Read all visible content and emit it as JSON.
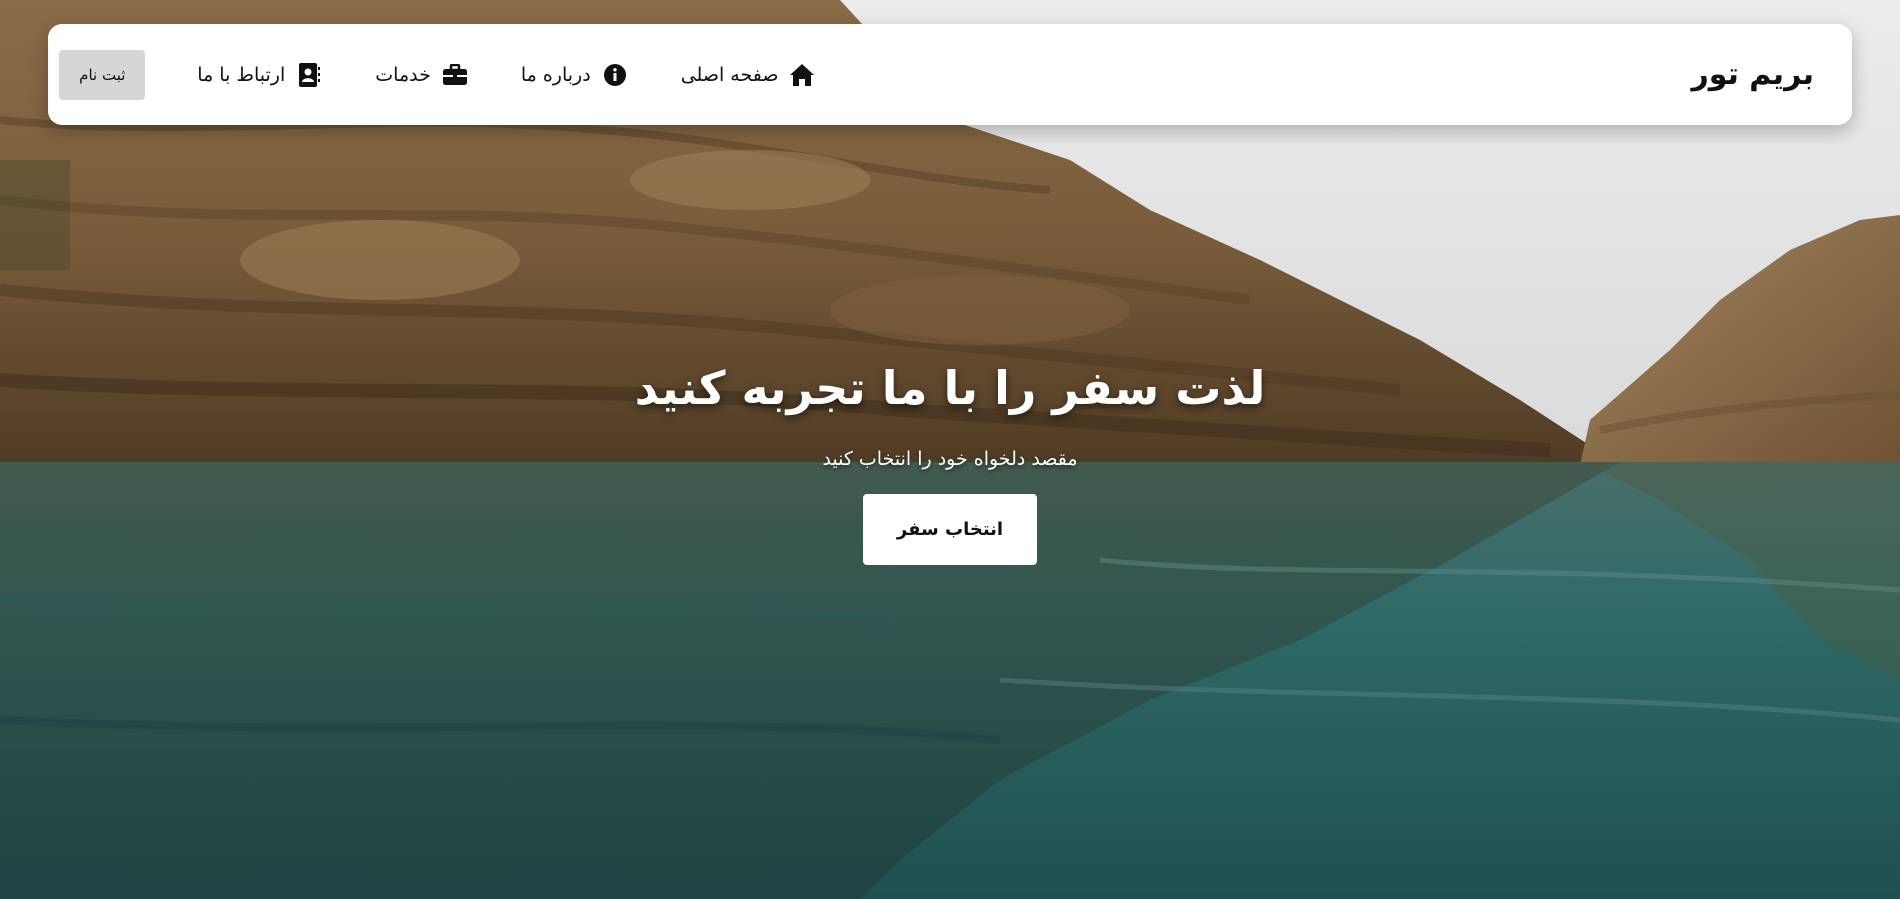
{
  "nav": {
    "brand": "بریم تور",
    "items": [
      {
        "label": "صفحه اصلی",
        "icon": "home-icon"
      },
      {
        "label": "درباره ما",
        "icon": "info-icon"
      },
      {
        "label": "خدمات",
        "icon": "briefcase-icon"
      },
      {
        "label": "ارتباط با ما",
        "icon": "contact-card-icon"
      }
    ],
    "signup_label": "ثبت نام"
  },
  "hero": {
    "title": "لذت سفر را با ما تجربه کنید",
    "subtitle": "مقصد دلخواه خود را انتخاب کنید",
    "cta_label": "انتخاب سفر"
  },
  "colors": {
    "navbar_bg": "#ffffff",
    "signup_bg": "#d6d6d6",
    "water": "#2d5d5a",
    "rock": "#8a6a45",
    "sky": "#d9d9d9"
  }
}
